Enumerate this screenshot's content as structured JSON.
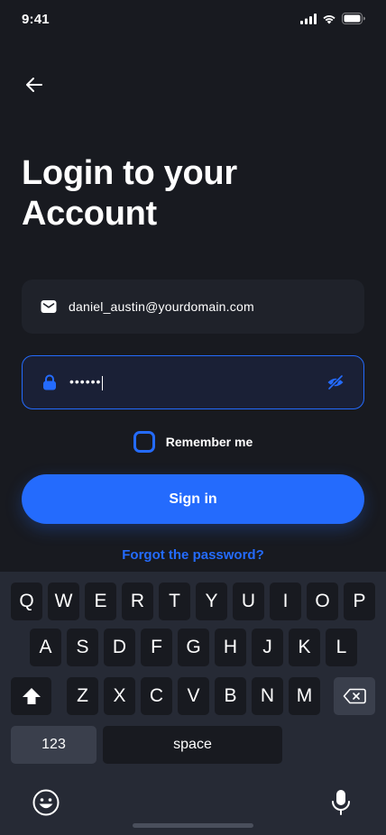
{
  "status": {
    "time": "9:41"
  },
  "title": {
    "line1": "Login to your",
    "line2": "Account"
  },
  "email": {
    "value": "daniel_austin@yourdomain.com",
    "icon": "mail-icon"
  },
  "password": {
    "value": "••••••",
    "icon": "lock-icon",
    "toggle_icon": "eye-slash-icon"
  },
  "remember": {
    "label": "Remember me",
    "checked": false
  },
  "signin": {
    "label": "Sign in"
  },
  "forgot": {
    "label": "Forgot the password?"
  },
  "colors": {
    "accent": "#246bfd",
    "background": "#181a20",
    "field": "#1f222a"
  },
  "keyboard": {
    "row1": [
      "Q",
      "W",
      "E",
      "R",
      "T",
      "Y",
      "U",
      "I",
      "O",
      "P"
    ],
    "row2": [
      "A",
      "S",
      "D",
      "F",
      "G",
      "H",
      "J",
      "K",
      "L"
    ],
    "row3": [
      "Z",
      "X",
      "C",
      "V",
      "B",
      "N",
      "M"
    ],
    "numbers_label": "123",
    "space_label": "space"
  }
}
